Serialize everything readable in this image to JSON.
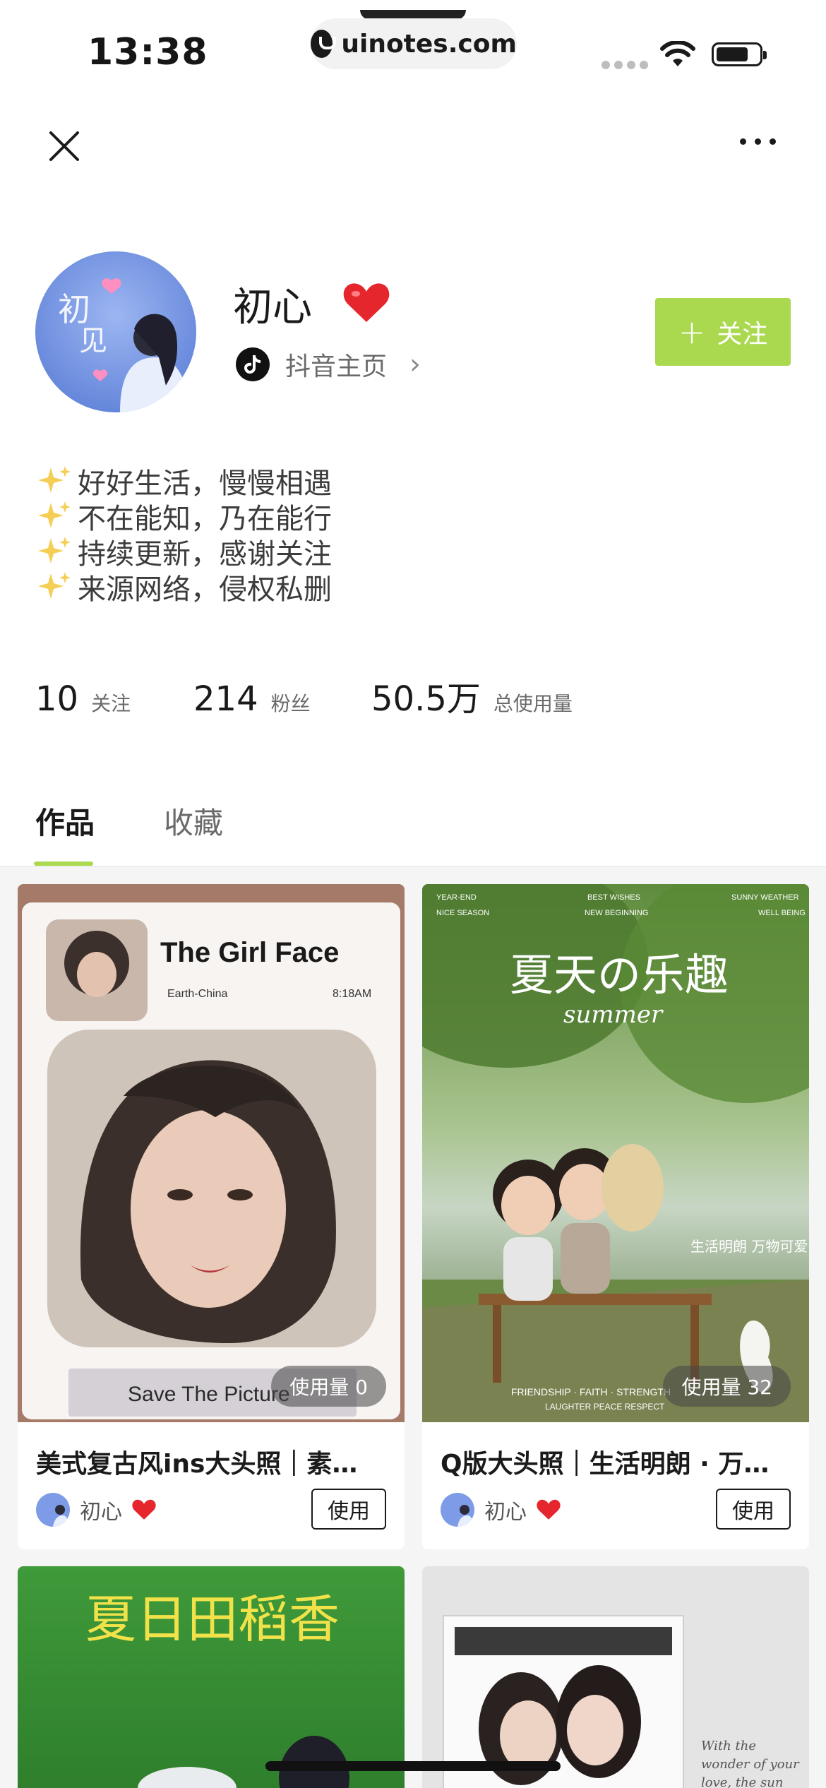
{
  "status_bar": {
    "time": "13:38",
    "url": "uinotes.com"
  },
  "profile": {
    "username": "初心",
    "douyin_link": "抖音主页",
    "follow_label": "关注",
    "bio": [
      "好好生活，慢慢相遇",
      "不在能知，乃在能行",
      "持续更新，感谢关注",
      "来源网络，侵权私删"
    ],
    "stats": [
      {
        "value": "10",
        "label": "关注"
      },
      {
        "value": "214",
        "label": "粉丝"
      },
      {
        "value": "50.5万",
        "label": "总使用量"
      }
    ]
  },
  "tabs": [
    {
      "label": "作品",
      "active": true
    },
    {
      "label": "收藏",
      "active": false
    }
  ],
  "cards": [
    {
      "title": "美式复古风ins大头照｜素…",
      "usage": "使用量 0",
      "author": "初心",
      "use_label": "使用",
      "thumb_texts": {
        "heading": "The Girl Face",
        "location": "Earth-China",
        "time": "8:18AM",
        "button": "Save The Picture"
      }
    },
    {
      "title": "Q版大头照｜生活明朗 · 万…",
      "usage": "使用量 32",
      "author": "初心",
      "use_label": "使用",
      "thumb_texts": {
        "heading": "夏天の乐趣",
        "subheading": "summer",
        "top_left": "YEAR-END",
        "top_left2": "NICE SEASON",
        "top_mid": "BEST WISHES",
        "top_mid2": "NEW BEGINNING",
        "top_right": "SUNNY WEATHER",
        "top_right2": "WELL BEING",
        "bottom": "FRIENDSHIP · FAITH · STRENGTH",
        "bottom2": "LAUGHTER  PEACE  RESPECT",
        "handwriting": "生活明朗 万物可爱"
      }
    },
    {
      "thumb_texts": {
        "heading": "夏日田稻香"
      }
    },
    {
      "thumb_texts": {
        "handwriting": "With the wonder of your love, the sun above always shines"
      }
    }
  ],
  "colors": {
    "accent": "#aad94f",
    "text": "#1a1a1a",
    "muted": "#6a6a6a"
  }
}
